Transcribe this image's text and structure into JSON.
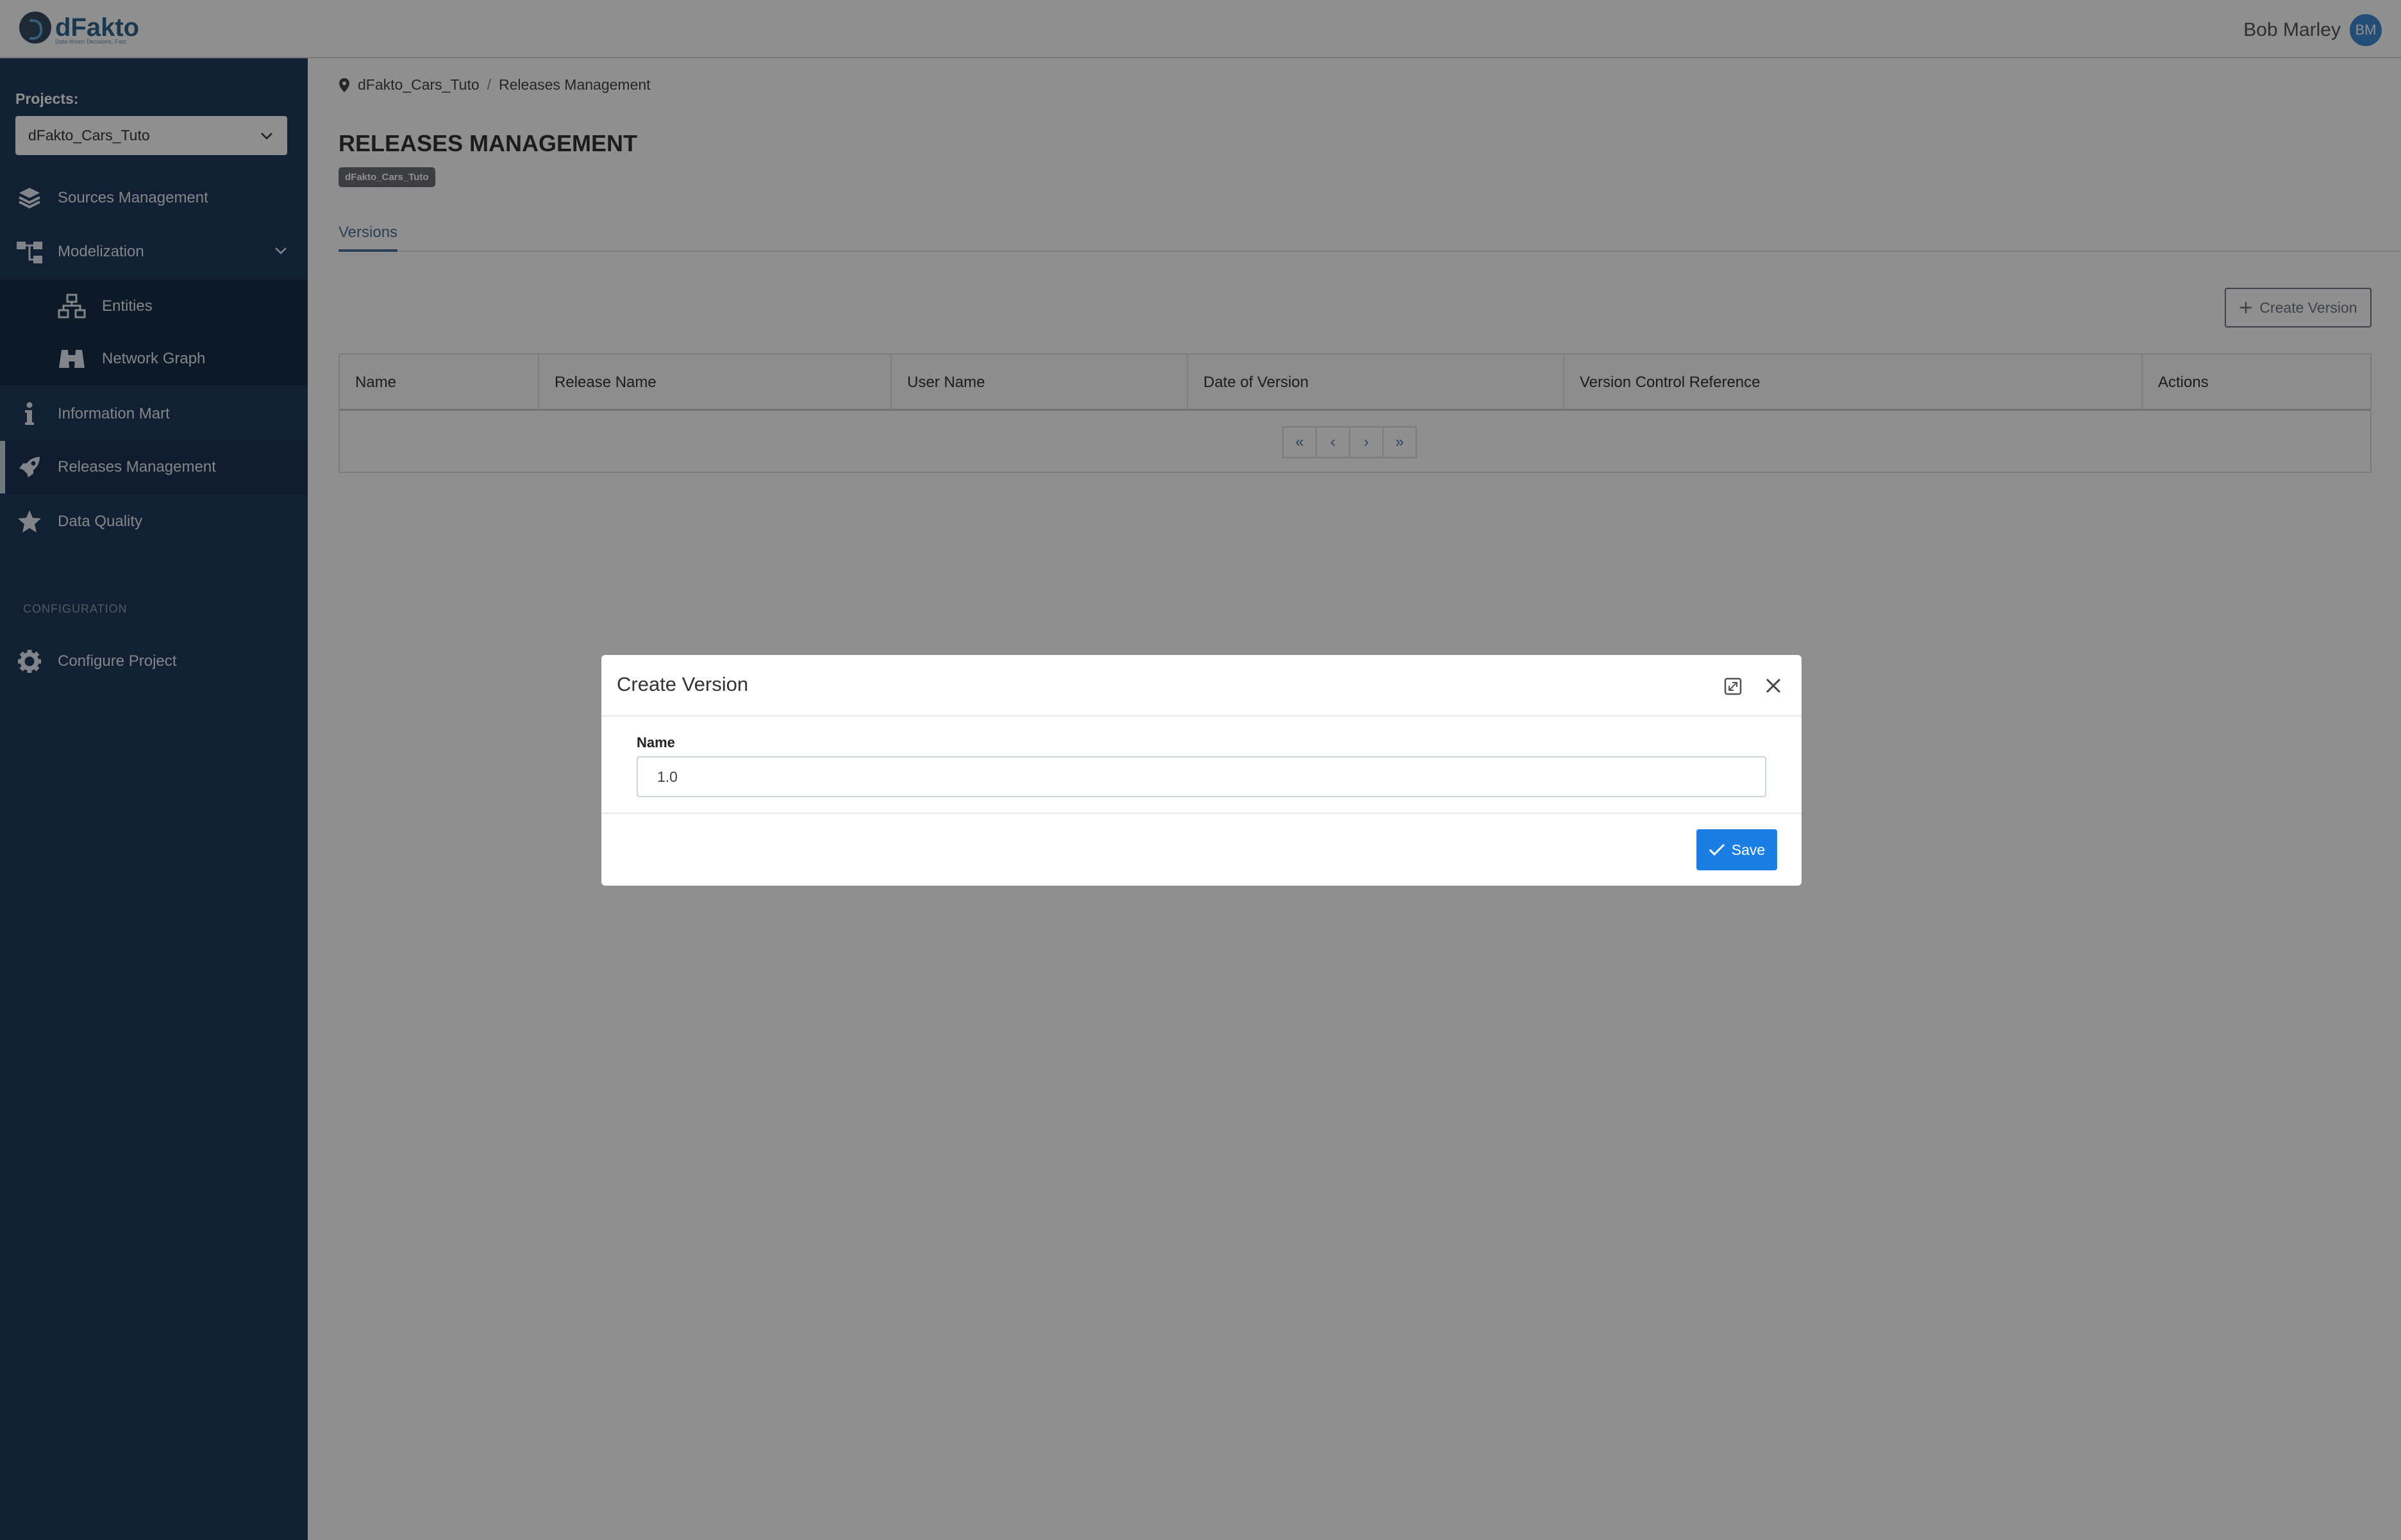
{
  "header": {
    "logo_text": "dFakto",
    "logo_tagline": "Data-driven Decisions, Fast",
    "user_name": "Bob Marley",
    "user_initials": "BM"
  },
  "sidebar": {
    "projects_label": "Projects:",
    "project_selected": "dFakto_Cars_Tuto",
    "items": [
      {
        "label": "Sources Management",
        "icon": "layers-icon"
      },
      {
        "label": "Modelization",
        "icon": "hierarchy-icon"
      },
      {
        "label": "Entities",
        "icon": "sitemap-icon"
      },
      {
        "label": "Network Graph",
        "icon": "binoculars-icon"
      },
      {
        "label": "Information Mart",
        "icon": "info-icon"
      },
      {
        "label": "Releases Management",
        "icon": "rocket-icon"
      },
      {
        "label": "Data Quality",
        "icon": "star-icon"
      }
    ],
    "config_label": "CONFIGURATION",
    "configure_project": "Configure Project"
  },
  "main": {
    "breadcrumb": [
      "dFakto_Cars_Tuto",
      "Releases Management"
    ],
    "breadcrumb_sep": "/",
    "title": "RELEASES MANAGEMENT",
    "project_badge": "dFakto_Cars_Tuto",
    "tab": "Versions",
    "create_button": "Create Version",
    "table": {
      "columns": [
        "Name",
        "Release Name",
        "User Name",
        "Date of Version",
        "Version Control Reference",
        "Actions"
      ]
    },
    "pager": [
      "«",
      "‹",
      "›",
      "»"
    ]
  },
  "modal": {
    "title": "Create Version",
    "name_label": "Name",
    "name_value": "1.0",
    "save_label": "Save"
  }
}
